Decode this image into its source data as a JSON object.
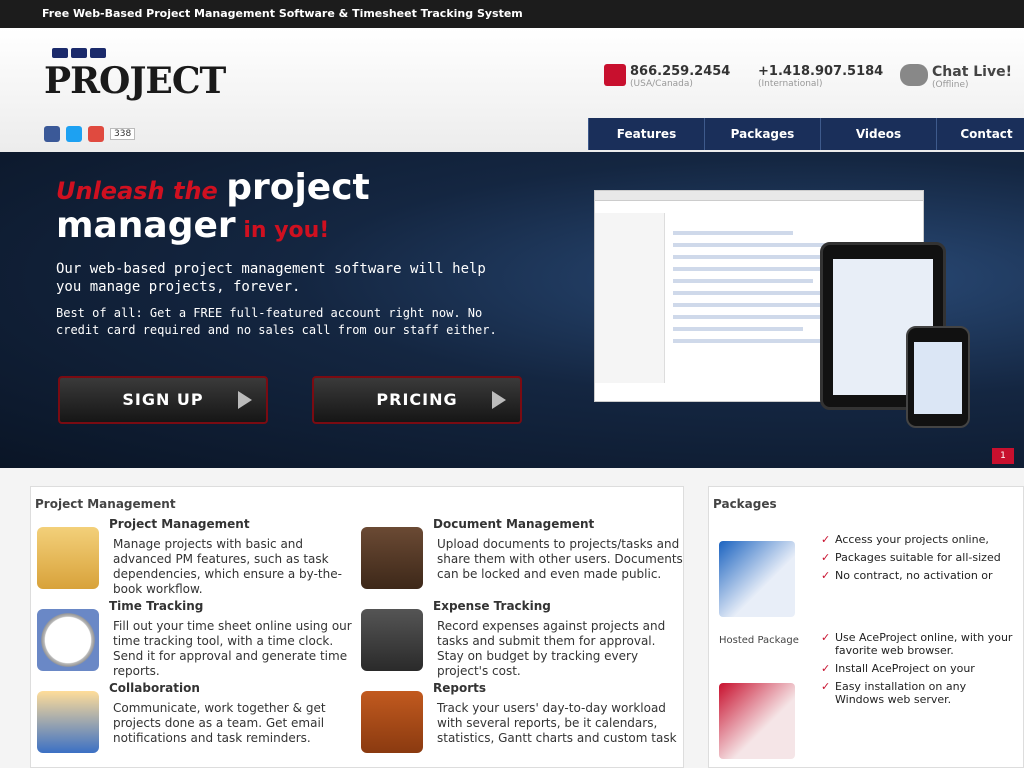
{
  "topbar": {
    "title": "Free Web-Based Project Management Software & Timesheet Tracking System"
  },
  "logo": {
    "text": "PROJECT"
  },
  "social": {
    "count": "338"
  },
  "contact": {
    "phone1": "866.259.2454",
    "phone1_sub": "(USA/Canada)",
    "phone2": "+1.418.907.5184",
    "phone2_sub": "(International)",
    "chat": "Chat Live!",
    "chat_sub": "(Offline)"
  },
  "nav": [
    {
      "label": "Features"
    },
    {
      "label": "Packages"
    },
    {
      "label": "Videos"
    },
    {
      "label": "Contact"
    }
  ],
  "hero": {
    "t1": "Unleash the ",
    "t2": "project",
    "t3": "manager",
    "t4": " in you!",
    "p1": "Our web-based project management software will help you manage projects, forever.",
    "p2": "Best of all: Get a FREE full-featured account right now. No credit card required and no sales call from our staff either.",
    "signup": "SIGN UP",
    "pricing": "PRICING"
  },
  "counter": "1",
  "features_panel": {
    "heading": "Project Management",
    "items": [
      {
        "title": "Project Management",
        "text": "Manage projects with basic and advanced PM features, such as task dependencies, which ensure a by-the-book workflow."
      },
      {
        "title": "Document Management",
        "text": "Upload documents to projects/tasks and share them with other users. Documents can be locked and even made public."
      },
      {
        "title": "Time Tracking",
        "text": "Fill out your time sheet online using our time tracking tool, with a time clock. Send it for approval and generate time reports."
      },
      {
        "title": "Expense Tracking",
        "text": "Record expenses against projects and tasks and submit them for approval. Stay on budget by tracking every project's cost."
      },
      {
        "title": "Collaboration",
        "text": "Communicate, work together & get projects done as a team. Get email notifications and task reminders."
      },
      {
        "title": "Reports",
        "text": "Track your users' day-to-day workload with several reports, be it calendars, statistics, Gantt charts and custom task"
      }
    ]
  },
  "packages": {
    "heading": "Packages",
    "hosted_label": "Hosted Package",
    "hosted_features": [
      "Access your projects online,",
      "Packages suitable for all-sized",
      "No contract, no activation or"
    ],
    "intranet_features": [
      "Use AceProject online, with your favorite web browser.",
      "Install AceProject on your",
      "Easy installation on any Windows web server."
    ]
  }
}
